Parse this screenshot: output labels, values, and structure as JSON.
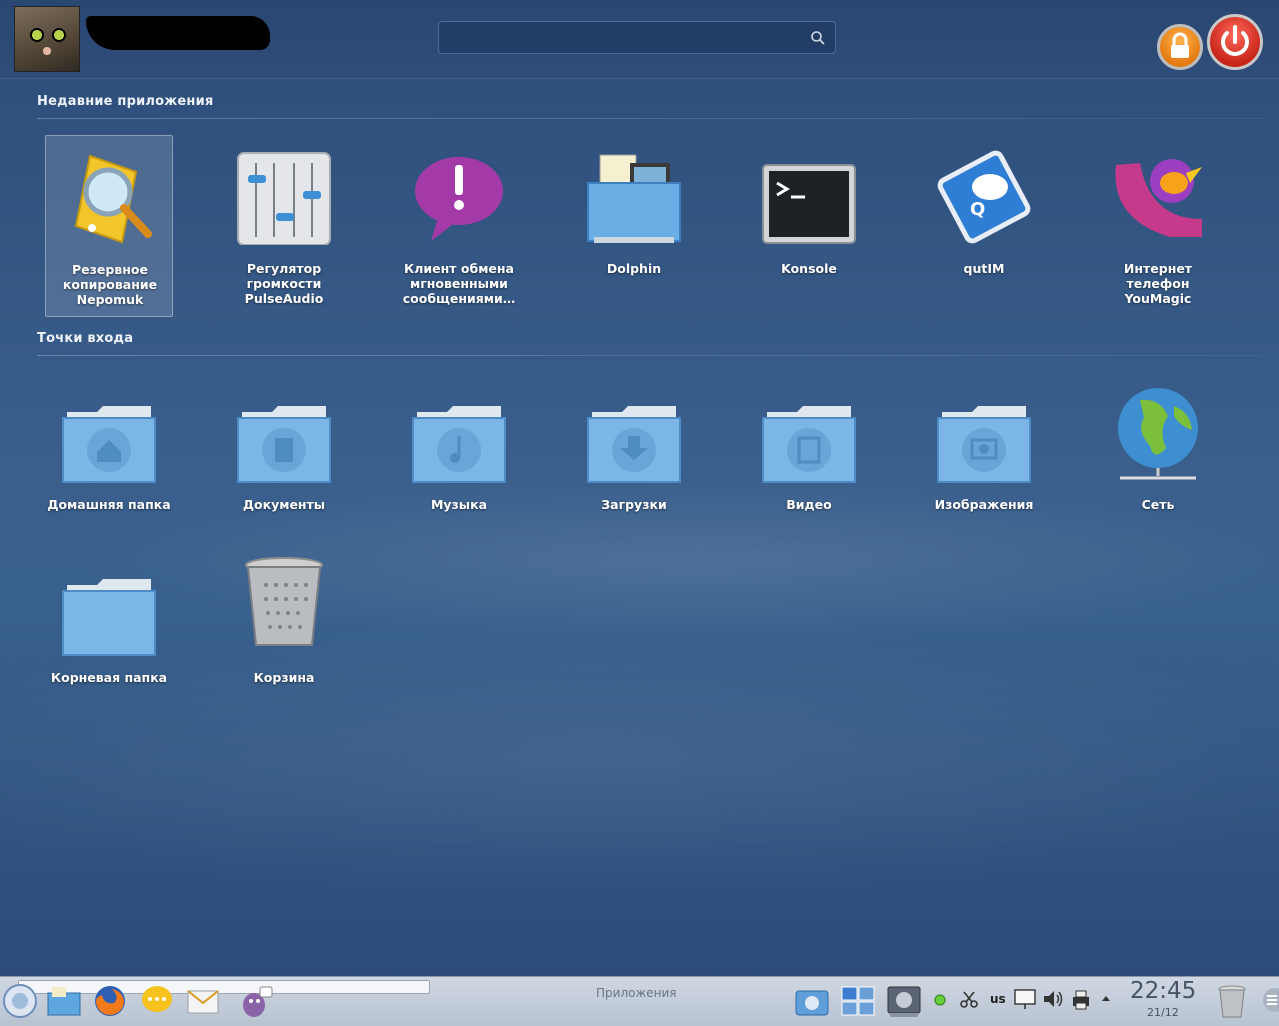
{
  "header": {
    "username": "████████",
    "search": {
      "value": "",
      "placeholder": ""
    },
    "lock_label": "",
    "power_label": ""
  },
  "sections": {
    "recent_title": "Недавние приложения",
    "places_title": "Точки входа"
  },
  "recent_apps": [
    {
      "label": "Резервное копирование Nepomuk",
      "icon": "nepomuk-backup-icon",
      "selected": true
    },
    {
      "label": "Регулятор громкости PulseAudio",
      "icon": "volume-mixer-icon"
    },
    {
      "label": "Клиент обмена мгновенными сообщениями…",
      "icon": "im-client-icon"
    },
    {
      "label": "Dolphin",
      "icon": "dolphin-icon"
    },
    {
      "label": "Konsole",
      "icon": "terminal-icon"
    },
    {
      "label": "qutIM",
      "icon": "qutim-icon"
    },
    {
      "label": "Интернет телефон YouMagic",
      "icon": "youmagic-icon"
    }
  ],
  "places": [
    {
      "label": "Домашняя папка",
      "icon": "home-folder-icon"
    },
    {
      "label": "Документы",
      "icon": "documents-folder-icon"
    },
    {
      "label": "Музыка",
      "icon": "music-folder-icon"
    },
    {
      "label": "Загрузки",
      "icon": "downloads-folder-icon"
    },
    {
      "label": "Видео",
      "icon": "video-folder-icon"
    },
    {
      "label": "Изображения",
      "icon": "pictures-folder-icon"
    },
    {
      "label": "Сеть",
      "icon": "network-globe-icon"
    },
    {
      "label": "Корневая папка",
      "icon": "root-folder-icon"
    },
    {
      "label": "Корзина",
      "icon": "trash-icon"
    }
  ],
  "taskbar": {
    "launchers": [
      "kickoff-menu-icon",
      "dolphin-launcher-icon",
      "firefox-icon",
      "chat-icon",
      "mail-icon",
      "pidgin-icon"
    ],
    "task_label": "Приложения",
    "keyboard_layout": "us",
    "clock_time": "22:45",
    "clock_date": "21/12"
  },
  "colors": {
    "background": "#3a5f8d",
    "header": "#2a4672",
    "lock": "#e57a12",
    "power": "#c8241a",
    "panel": "#c3ccd8"
  }
}
